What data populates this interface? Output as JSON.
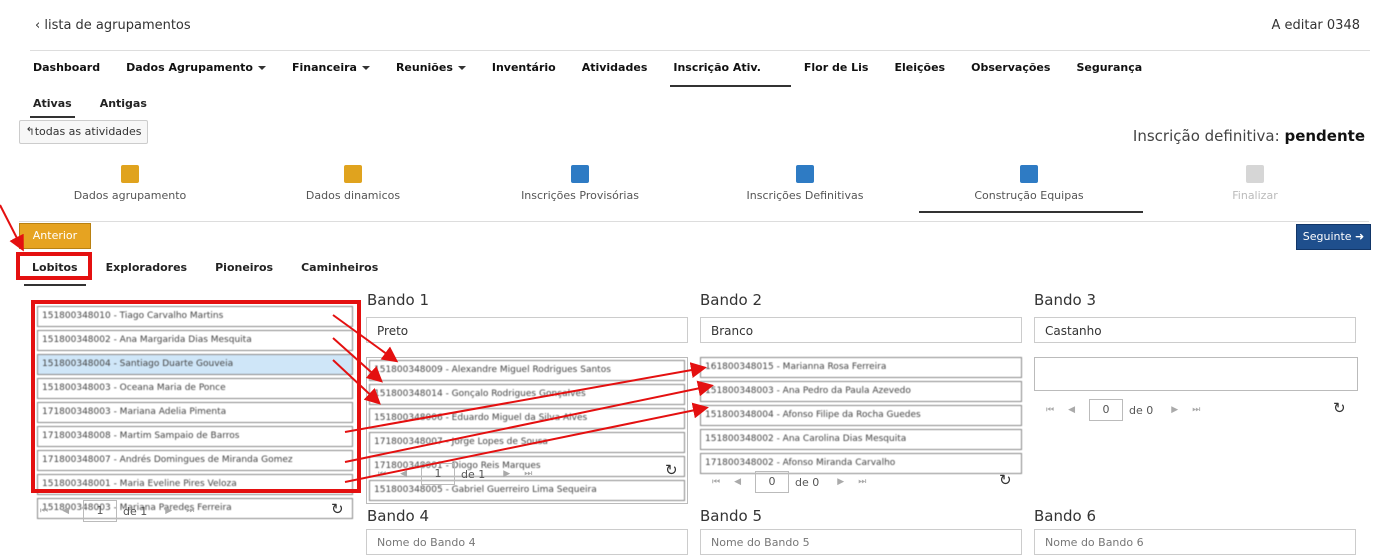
{
  "topbar": {
    "back_label": "lista de agrupamentos",
    "editing_label": "A editar 0348"
  },
  "nav": [
    {
      "label": "Dashboard",
      "dropdown": false
    },
    {
      "label": "Dados Agrupamento",
      "dropdown": true
    },
    {
      "label": "Financeira",
      "dropdown": true
    },
    {
      "label": "Reuniões",
      "dropdown": true
    },
    {
      "label": "Inventário",
      "dropdown": false
    },
    {
      "label": "Atividades",
      "dropdown": false
    },
    {
      "label": "Inscrição Ativ.",
      "dropdown": false,
      "active": true
    },
    {
      "label": "Flor de Lis",
      "dropdown": false
    },
    {
      "label": "Eleições",
      "dropdown": false
    },
    {
      "label": "Observações",
      "dropdown": false
    },
    {
      "label": "Segurança",
      "dropdown": false
    }
  ],
  "subnav": {
    "ativas": "Ativas",
    "antigas": "Antigas"
  },
  "all_activities_label": "todas as atividades",
  "definitive": {
    "label": "Inscrição definitiva:",
    "status": "pendente"
  },
  "steps": [
    {
      "label": "Dados agrupamento",
      "icon": "user-icon",
      "color": "#e0a31e"
    },
    {
      "label": "Dados dinamicos",
      "icon": "user-icon",
      "color": "#e0a31e"
    },
    {
      "label": "Inscrições Provisórias",
      "icon": "home-icon",
      "color": "#2e7bc4"
    },
    {
      "label": "Inscrições Definitivas",
      "icon": "home-icon",
      "color": "#2e7bc4"
    },
    {
      "label": "Construção Equipas",
      "icon": "home-icon",
      "color": "#2e7bc4"
    },
    {
      "label": "Finalizar",
      "icon": "heart-icon",
      "color": "#d6d6d6"
    }
  ],
  "buttons": {
    "anterior": "Anterior",
    "seguinte": "Seguinte"
  },
  "section_tabs": [
    "Lobitos",
    "Exploradores",
    "Pioneiros",
    "Caminheiros"
  ],
  "available": {
    "items": [
      "151800348010 - Tiago Carvalho Martins",
      "151800348002 - Ana Margarida Dias Mesquita",
      "151800348004 - Santiago Duarte Gouveia",
      "151800348003 - Oceana Maria de Ponce",
      "171800348003 - Mariana Adelia Pimenta",
      "171800348008 - Martim Sampaio de Barros",
      "171800348007 - Andrés Domingues de Miranda Gomez",
      "151800348001 - Maria Eveline Pires Veloza",
      "151800348003 - Mariana Paredes Ferreira"
    ],
    "page": "1",
    "of_label": "de 1"
  },
  "bandos": [
    {
      "title": "Bando 1",
      "name": "Preto",
      "placeholder": "",
      "members": [
        "151800348009 - Alexandre Miguel Rodrigues Santos",
        "151800348014 - Gonçalo Rodrigues Gonçalves",
        "151800348006 - Eduardo Miguel da Silva Alves",
        "171800348007 - Jorge Lopes de Sousa",
        "171800348001 - Diogo Reis Marques",
        "151800348005 - Gabriel Guerreiro Lima Sequeira"
      ],
      "page": "1",
      "of_label": "de 1"
    },
    {
      "title": "Bando 2",
      "name": "Branco",
      "placeholder": "",
      "members": [
        "161800348015 - Marianna Rosa Ferreira",
        "151800348003 - Ana Pedro da Paula Azevedo",
        "151800348004 - Afonso Filipe da Rocha Guedes",
        "151800348002 - Ana Carolina Dias Mesquita",
        "171800348002 - Afonso Miranda Carvalho"
      ],
      "page": "0",
      "of_label": "de 0"
    },
    {
      "title": "Bando 3",
      "name": "Castanho",
      "placeholder": "",
      "members": [],
      "page": "0",
      "of_label": "de 0"
    },
    {
      "title": "Bando 4",
      "name": "",
      "placeholder": "Nome do Bando 4"
    },
    {
      "title": "Bando 5",
      "name": "",
      "placeholder": "Nome do Bando 5"
    },
    {
      "title": "Bando 6",
      "name": "",
      "placeholder": "Nome do Bando 6"
    }
  ],
  "colors": {
    "accent_orange": "#e6a321",
    "accent_blue": "#1f4f8d",
    "annotation_red": "#e41010"
  }
}
